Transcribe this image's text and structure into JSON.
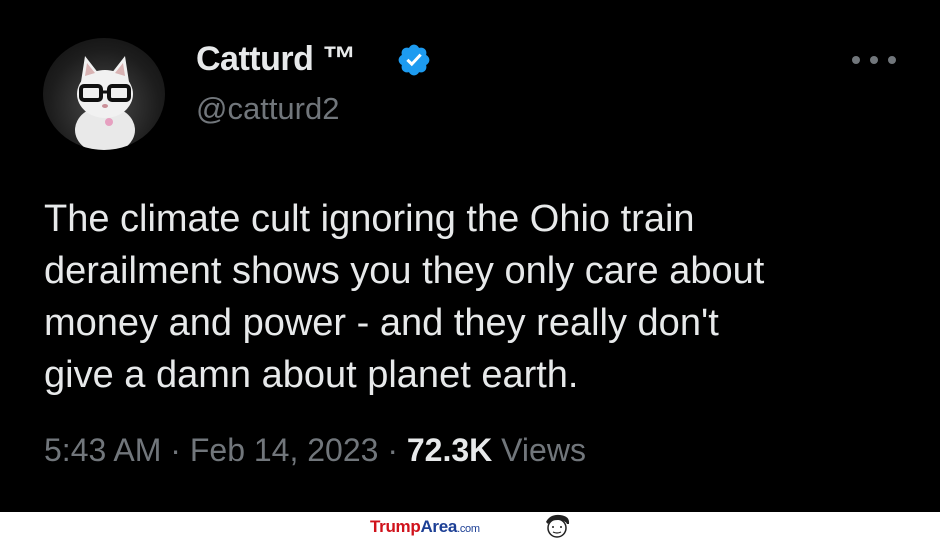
{
  "tweet": {
    "display_name": "Catturd ™",
    "handle": "@catturd2",
    "text": "The climate cult ignoring the Ohio train\nderailment shows you they only care about\nmoney and power - and they really don't\ngive a damn about planet earth.",
    "time": "5:43 AM",
    "date": "Feb 14, 2023",
    "separator": "·",
    "views_count": "72.3K",
    "views_label": "Views",
    "verified_badge_icon": "verified-badge-icon",
    "more_icon": "more-options-icon"
  },
  "footer": {
    "logo_part1": "Trump",
    "logo_part2": "Area",
    "logo_part3": ".com"
  },
  "colors": {
    "background": "#000000",
    "primary_text": "#e7e9ea",
    "secondary_text": "#71767b",
    "verified_blue": "#1d9bf0",
    "logo_red": "#d0121b",
    "logo_blue": "#1c3f95"
  }
}
